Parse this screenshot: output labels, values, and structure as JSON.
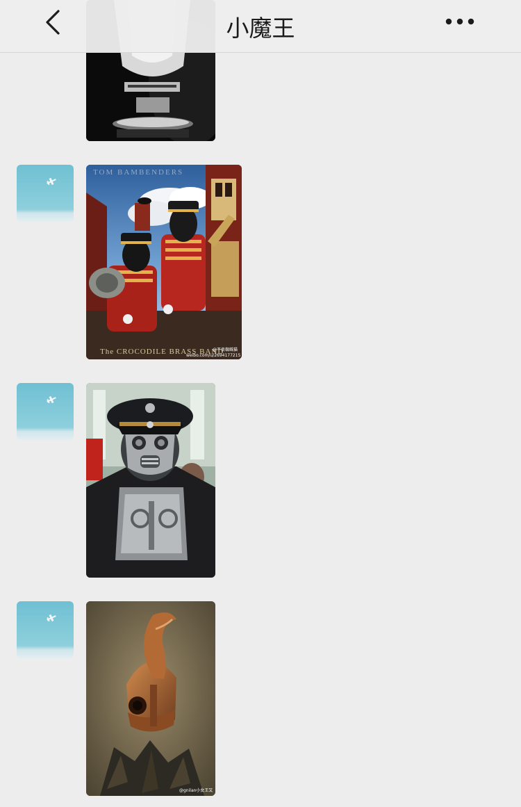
{
  "header": {
    "title": "小魔王",
    "back_icon": "chevron-left-icon",
    "more_icon": "more-horizontal-icon"
  },
  "messages": [
    {
      "sender": "contact",
      "avatar": "sky-plane-avatar",
      "content": "image",
      "image_subject": "lantern-top",
      "partial": true
    },
    {
      "sender": "contact",
      "avatar": "sky-plane-avatar",
      "content": "image",
      "image_subject": "crocodile-brass-band",
      "image_text": {
        "top": "TOM BAMBENDERS",
        "caption": "The CROCODILE BRASS BAND",
        "watermark": "@不良蜘蛛猫",
        "url": "weibo.com/u/2694177215"
      }
    },
    {
      "sender": "contact",
      "avatar": "sky-plane-avatar",
      "content": "image",
      "image_subject": "steampunk-officer-mask"
    },
    {
      "sender": "contact",
      "avatar": "sky-plane-avatar",
      "content": "image",
      "image_subject": "leather-bird-helmet",
      "image_text": {
        "watermark": "@gnilan小女王又"
      }
    }
  ],
  "colors": {
    "background": "#ededed",
    "nav": "#ededed",
    "text": "#1b1b1b"
  }
}
